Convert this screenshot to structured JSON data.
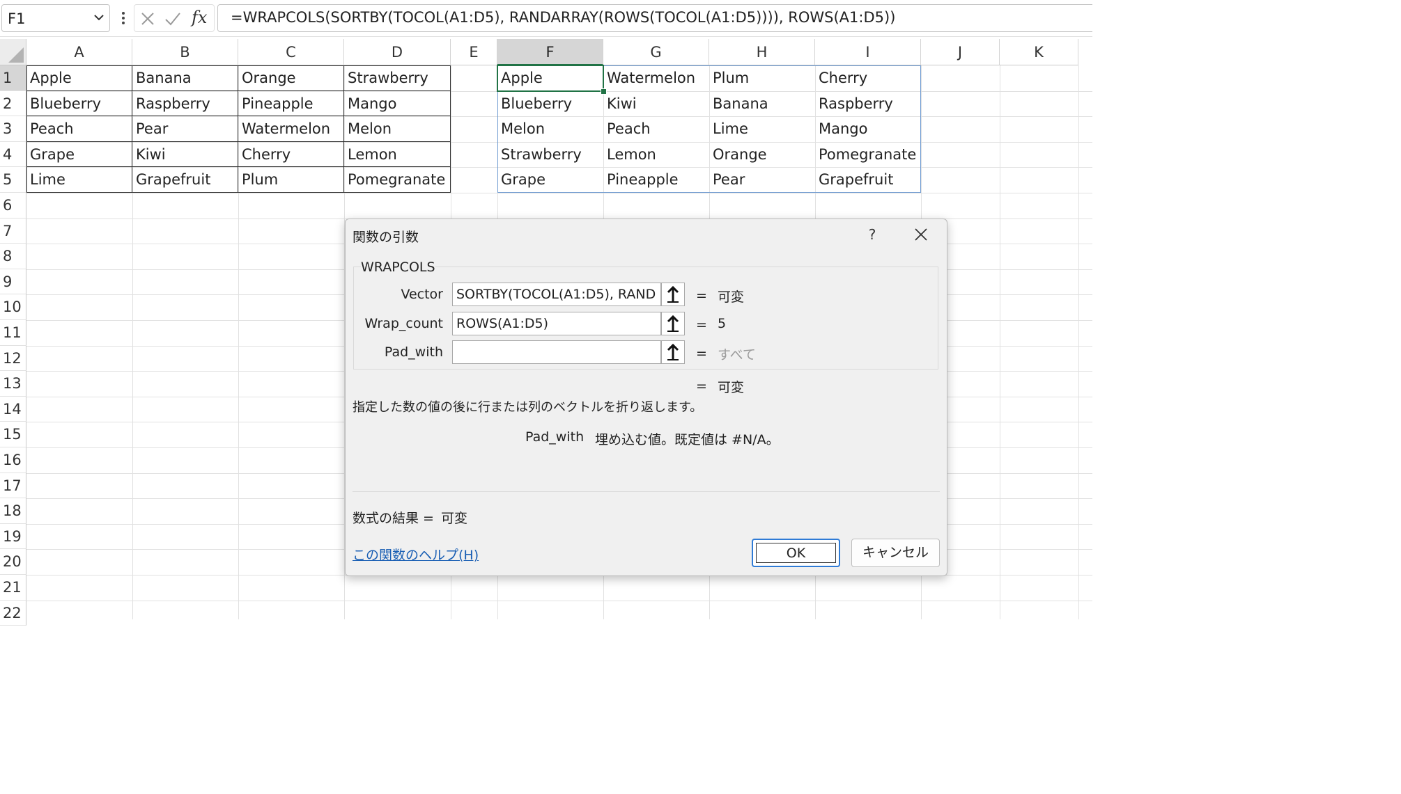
{
  "formula_bar": {
    "name_box": "F1",
    "fx_label": "fx",
    "formula": "=WRAPCOLS(SORTBY(TOCOL(A1:D5), RANDARRAY(ROWS(TOCOL(A1:D5)))), ROWS(A1:D5))"
  },
  "grid": {
    "columns": [
      "A",
      "B",
      "C",
      "D",
      "E",
      "F",
      "G",
      "H",
      "I",
      "J",
      "K"
    ],
    "selected_column": "F",
    "rows": [
      "1",
      "2",
      "3",
      "4",
      "5",
      "6",
      "7",
      "8",
      "9",
      "10",
      "11",
      "12",
      "13",
      "14",
      "15",
      "16",
      "17",
      "18",
      "19",
      "20",
      "21",
      "22"
    ],
    "selected_row": "1",
    "source": [
      [
        "Apple",
        "Banana",
        "Orange",
        "Strawberry"
      ],
      [
        "Blueberry",
        "Raspberry",
        "Pineapple",
        "Mango"
      ],
      [
        "Peach",
        "Pear",
        "Watermelon",
        "Melon"
      ],
      [
        "Grape",
        "Kiwi",
        "Cherry",
        "Lemon"
      ],
      [
        "Lime",
        "Grapefruit",
        "Plum",
        "Pomegranate"
      ]
    ],
    "result": [
      [
        "Apple",
        "Watermelon",
        "Plum",
        "Cherry"
      ],
      [
        "Blueberry",
        "Kiwi",
        "Banana",
        "Raspberry"
      ],
      [
        "Melon",
        "Peach",
        "Lime",
        "Mango"
      ],
      [
        "Strawberry",
        "Lemon",
        "Orange",
        "Pomegranate"
      ],
      [
        "Grape",
        "Pineapple",
        "Pear",
        "Grapefruit"
      ]
    ]
  },
  "dialog": {
    "title": "関数の引数",
    "help": "?",
    "function_name": "WRAPCOLS",
    "args": [
      {
        "label": "Vector",
        "value": "SORTBY(TOCOL(A1:D5), RAND",
        "result": "可変"
      },
      {
        "label": "Wrap_count",
        "value": "ROWS(A1:D5)",
        "result": "5"
      },
      {
        "label": "Pad_with",
        "value": "",
        "result": "すべて"
      }
    ],
    "eq": "=",
    "overall_result": "可変",
    "description": "指定した数の値の後に行または列のベクトルを折り返します。",
    "arg_desc_name": "Pad_with",
    "arg_desc_text": "埋め込む値。既定値は #N/A。",
    "formula_result_label": "数式の結果 =",
    "formula_result_value": "可変",
    "help_link": "この関数のヘルプ(H)",
    "ok": "OK",
    "cancel": "キャンセル"
  }
}
